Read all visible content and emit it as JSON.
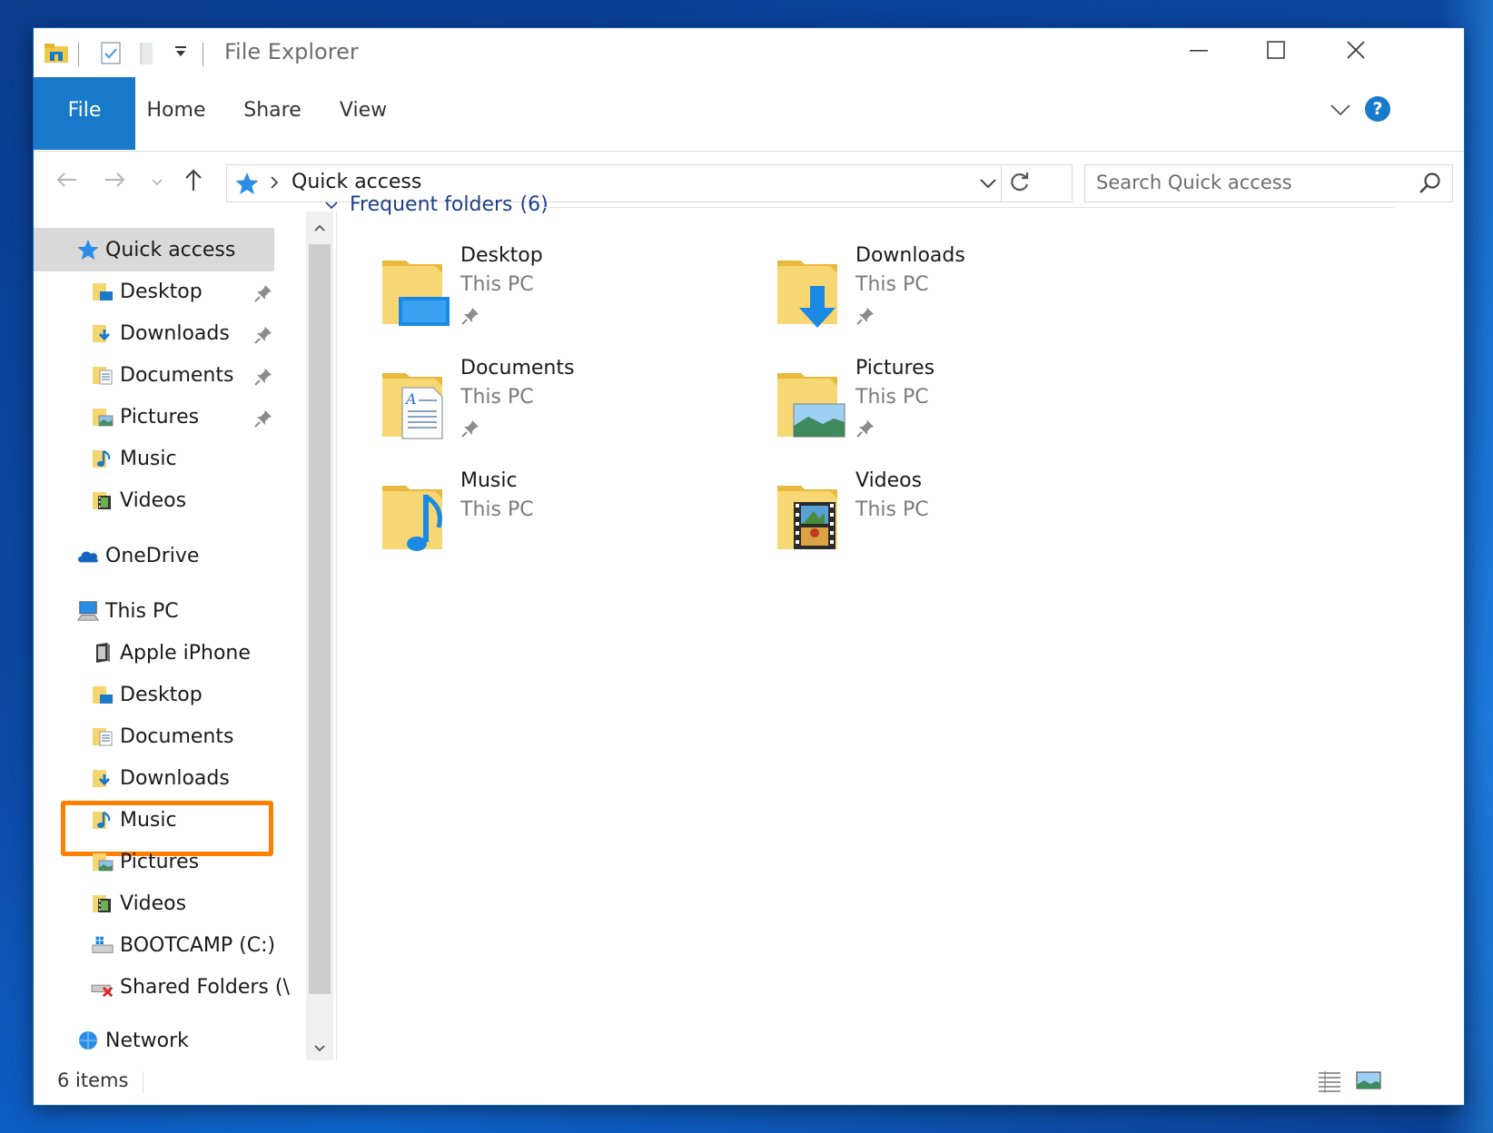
{
  "window": {
    "title": "File Explorer"
  },
  "ribbon": {
    "tabs": [
      "File",
      "Home",
      "Share",
      "View"
    ],
    "help": "?"
  },
  "address": {
    "crumb": "Quick access"
  },
  "search": {
    "placeholder": "Search Quick access"
  },
  "nav": {
    "quick_access": "Quick access",
    "quick_items": [
      "Desktop",
      "Downloads",
      "Documents",
      "Pictures",
      "Music",
      "Videos"
    ],
    "onedrive": "OneDrive",
    "this_pc": "This PC",
    "this_pc_items": [
      "Apple iPhone",
      "Desktop",
      "Documents",
      "Downloads",
      "Music",
      "Pictures",
      "Videos",
      "BOOTCAMP (C:)",
      "Shared Folders (\\"
    ],
    "network_partial": "Network"
  },
  "content": {
    "group_title": "Frequent folders",
    "group_count": "(6)",
    "folders": [
      {
        "name": "Desktop",
        "location": "This PC",
        "pinned": true,
        "icon": "desktop-folder-icon"
      },
      {
        "name": "Downloads",
        "location": "This PC",
        "pinned": true,
        "icon": "downloads-folder-icon"
      },
      {
        "name": "Documents",
        "location": "This PC",
        "pinned": true,
        "icon": "documents-folder-icon"
      },
      {
        "name": "Pictures",
        "location": "This PC",
        "pinned": true,
        "icon": "pictures-folder-icon"
      },
      {
        "name": "Music",
        "location": "This PC",
        "pinned": false,
        "icon": "music-folder-icon"
      },
      {
        "name": "Videos",
        "location": "This PC",
        "pinned": false,
        "icon": "videos-folder-icon"
      }
    ]
  },
  "status": {
    "items": "6 items"
  },
  "colors": {
    "accent": "#1979ca",
    "highlight": "#ff7f00",
    "folder": "#f5d56e",
    "group_header": "#1e3f8a"
  }
}
